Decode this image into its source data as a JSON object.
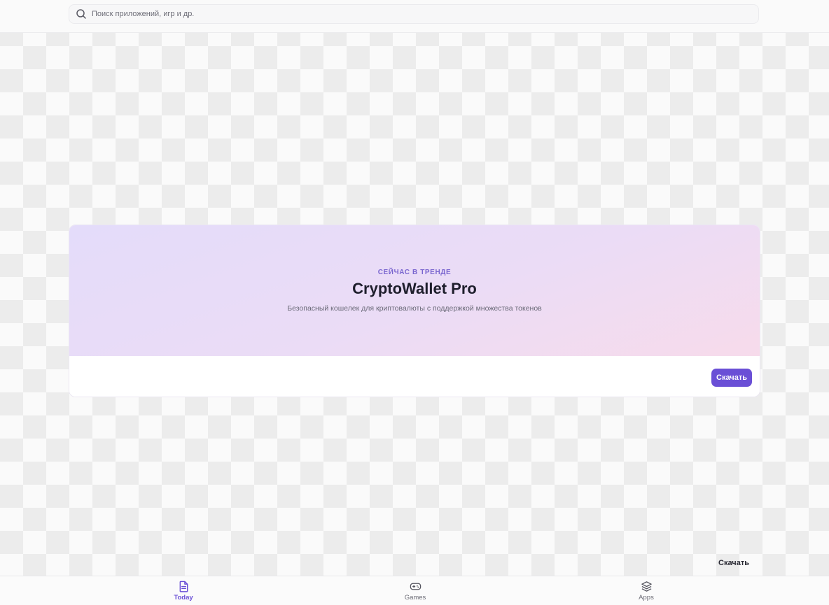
{
  "search": {
    "placeholder": "Поиск приложений, игр и др.",
    "value": ""
  },
  "featured": {
    "eyebrow": "СЕЙЧАС В ТРЕНДЕ",
    "title": "CryptoWallet Pro",
    "subtitle": "Безопасный кошелек для криптовалюты с поддержкой множества токенов",
    "button_label": "Скачать"
  },
  "floating_label": "Скачать",
  "tabs": [
    {
      "label": "Today",
      "icon": "document-icon",
      "active": true
    },
    {
      "label": "Games",
      "icon": "gamepad-icon",
      "active": false
    },
    {
      "label": "Apps",
      "icon": "layers-icon",
      "active": false
    }
  ],
  "colors": {
    "accent": "#6a4fd6",
    "eyebrow": "#7a66cf",
    "hero_start": "#e4dcfa",
    "hero_end": "#f7dbeb",
    "inactive_tab": "#6b6b75"
  }
}
